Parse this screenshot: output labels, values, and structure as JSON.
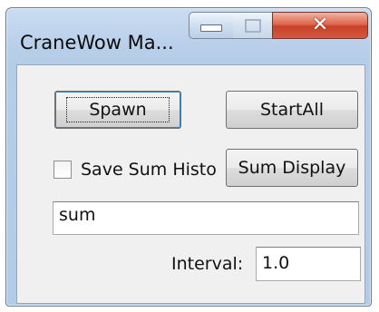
{
  "window": {
    "title": "CraneWow Ma...",
    "controls": {
      "minimize": "minimize-icon",
      "maximize": "maximize-icon",
      "close": "close-icon"
    }
  },
  "buttons": {
    "spawn": "Spawn",
    "start_all": "StartAll",
    "sum_display": "Sum Display"
  },
  "save_sum_histo": {
    "label": "Save Sum Histo",
    "checked": false
  },
  "sum_field": {
    "value": "sum"
  },
  "interval": {
    "label": "Interval:",
    "value": "1.0"
  },
  "colors": {
    "close_button": "#d3593c",
    "frame": "#b6cde8",
    "client": "#f0f0f0"
  }
}
